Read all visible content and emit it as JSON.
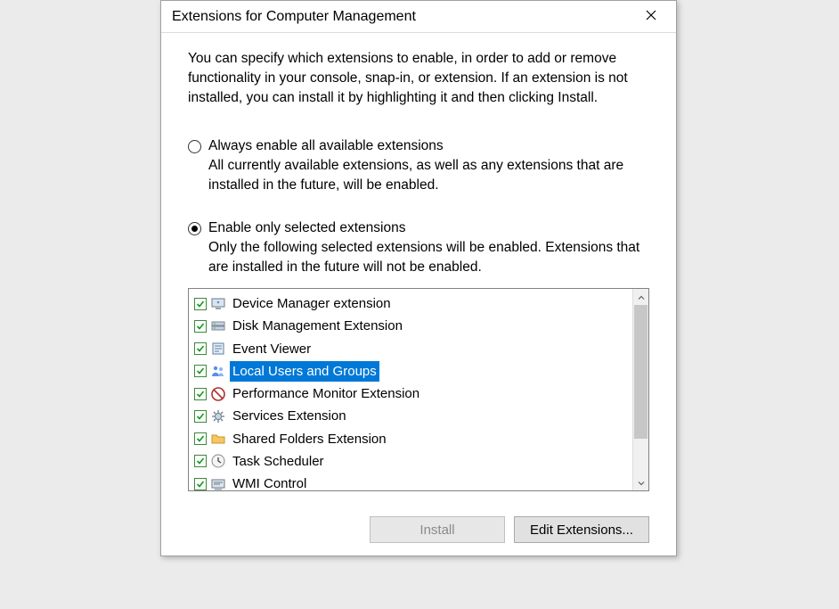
{
  "window": {
    "title": "Extensions for Computer Management"
  },
  "intro": "You can specify which extensions to enable, in order to add or remove functionality in your console, snap-in, or extension. If an extension is not installed, you can install it by highlighting it and then clicking Install.",
  "options": {
    "always": {
      "label": "Always enable all available extensions",
      "desc": "All currently available extensions, as well as any extensions that are installed in the future, will be enabled.",
      "selected": false
    },
    "selected": {
      "label": "Enable only selected extensions",
      "desc": "Only the following selected extensions will be enabled. Extensions that are installed in the future will not be enabled.",
      "selected": true
    }
  },
  "extensions": [
    {
      "label": "Device Manager extension",
      "checked": true,
      "icon": "device-manager-icon",
      "selected": false
    },
    {
      "label": "Disk Management Extension",
      "checked": true,
      "icon": "disk-management-icon",
      "selected": false
    },
    {
      "label": "Event Viewer",
      "checked": true,
      "icon": "event-viewer-icon",
      "selected": false
    },
    {
      "label": "Local Users and Groups",
      "checked": true,
      "icon": "local-users-groups-icon",
      "selected": true
    },
    {
      "label": "Performance Monitor Extension",
      "checked": true,
      "icon": "performance-monitor-icon",
      "selected": false
    },
    {
      "label": "Services Extension",
      "checked": true,
      "icon": "services-icon",
      "selected": false
    },
    {
      "label": "Shared Folders Extension",
      "checked": true,
      "icon": "shared-folders-icon",
      "selected": false
    },
    {
      "label": "Task Scheduler",
      "checked": true,
      "icon": "task-scheduler-icon",
      "selected": false
    },
    {
      "label": "WMI Control",
      "checked": true,
      "icon": "wmi-control-icon",
      "selected": false
    }
  ],
  "buttons": {
    "install": "Install",
    "edit": "Edit Extensions..."
  }
}
